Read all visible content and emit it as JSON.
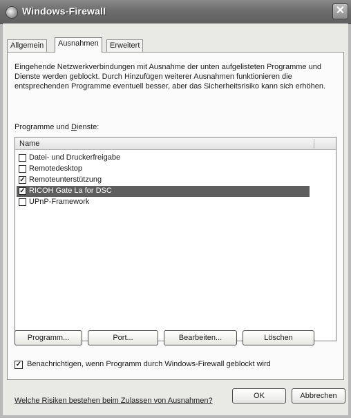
{
  "window": {
    "title": "Windows-Firewall",
    "close_glyph": "✕"
  },
  "tabs": [
    {
      "label": "Allgemein",
      "active": false
    },
    {
      "label": "Ausnahmen",
      "active": true
    },
    {
      "label": "Erweitert",
      "active": false
    }
  ],
  "exceptions": {
    "description": "Eingehende Netzwerkverbindungen mit Ausnahme der unten aufgelisteten Programme und Dienste werden geblockt. Durch Hinzufügen weiterer Ausnahmen funktionieren die entsprechenden Programme eventuell besser, aber das Sicherheitsrisiko kann sich erhöhen.",
    "list_label_pre": "Programme und ",
    "list_label_access": "D",
    "list_label_post": "ienste:",
    "column_header": "Name",
    "items": [
      {
        "label": "Datei- und Druckerfreigabe",
        "checked": false,
        "selected": false
      },
      {
        "label": "Remotedesktop",
        "checked": false,
        "selected": false
      },
      {
        "label": "Remoteunterstützung",
        "checked": true,
        "selected": false
      },
      {
        "label": "RICOH Gate La for DSC",
        "checked": true,
        "selected": true
      },
      {
        "label": "UPnP-Framework",
        "checked": false,
        "selected": false
      }
    ],
    "buttons": {
      "program": "Programm...",
      "port": "Port...",
      "edit": "Bearbeiten...",
      "delete": "Löschen"
    },
    "notify": {
      "label": "Benachrichtigen, wenn Programm durch Windows-Firewall geblockt wird",
      "checked": true
    },
    "risk_link": "Welche Risiken bestehen beim Zulassen von Ausnahmen?"
  },
  "footer": {
    "ok": "OK",
    "cancel": "Abbrechen"
  },
  "colors": {
    "selected_row": "#5e5e5e",
    "titlebar": "#6d6d6d"
  }
}
